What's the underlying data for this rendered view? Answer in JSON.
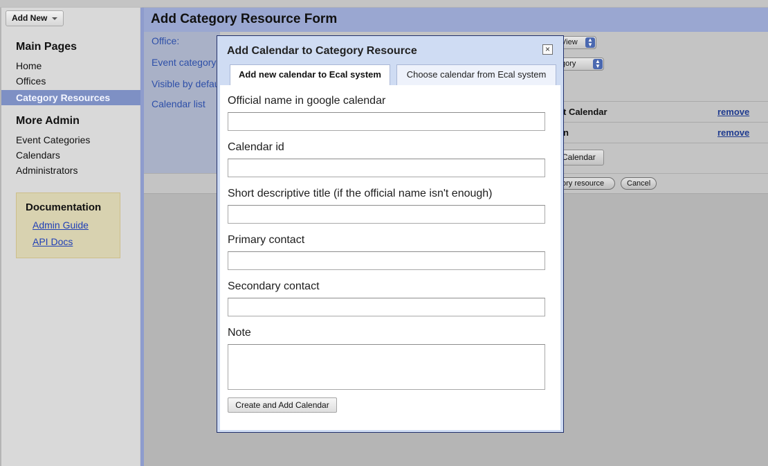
{
  "toolbar": {
    "add_new": "Add New"
  },
  "sidebar": {
    "main_heading": "Main Pages",
    "main_items": [
      {
        "label": "Home",
        "active": false
      },
      {
        "label": "Offices",
        "active": false
      },
      {
        "label": "Category Resources",
        "active": true
      }
    ],
    "more_heading": "More Admin",
    "more_items": [
      {
        "label": "Event Categories"
      },
      {
        "label": "Calendars"
      },
      {
        "label": "Administrators"
      }
    ],
    "docs": {
      "title": "Documentation",
      "links": [
        {
          "label": "Admin Guide"
        },
        {
          "label": "API Docs"
        }
      ]
    }
  },
  "page": {
    "title": "Add Category Resource Form",
    "form_labels": [
      "Office:",
      "Event category",
      "Visible by defau",
      "Calendar list"
    ],
    "right_panel": {
      "office_select": "View",
      "category_select": "gory",
      "calendar_rows": [
        {
          "name": "t Calendar",
          "action": "remove"
        },
        {
          "name": "n",
          "action": "remove"
        }
      ],
      "add_calendar_button": "Calendar",
      "save_button": "ory resource",
      "cancel_button": "Cancel"
    }
  },
  "modal": {
    "title": "Add Calendar to Category Resource",
    "close_glyph": "×",
    "tabs": [
      {
        "label": "Add new calendar to Ecal system",
        "active": true
      },
      {
        "label": "Choose calendar from Ecal system",
        "active": false
      }
    ],
    "fields": [
      {
        "label": "Official name in google calendar",
        "value": ""
      },
      {
        "label": "Calendar id",
        "value": ""
      },
      {
        "label": "Short descriptive title (if the official name isn't enough)",
        "value": ""
      },
      {
        "label": "Primary contact",
        "value": ""
      },
      {
        "label": "Secondary contact",
        "value": ""
      }
    ],
    "note_label": "Note",
    "note_value": "",
    "submit_label": "Create and Add Calendar"
  },
  "colors": {
    "sidebar_active": "#7e90c4",
    "header_band": "#9aa7d1",
    "link": "#1f3fb6",
    "modal_frame": "#cfdcf3"
  }
}
